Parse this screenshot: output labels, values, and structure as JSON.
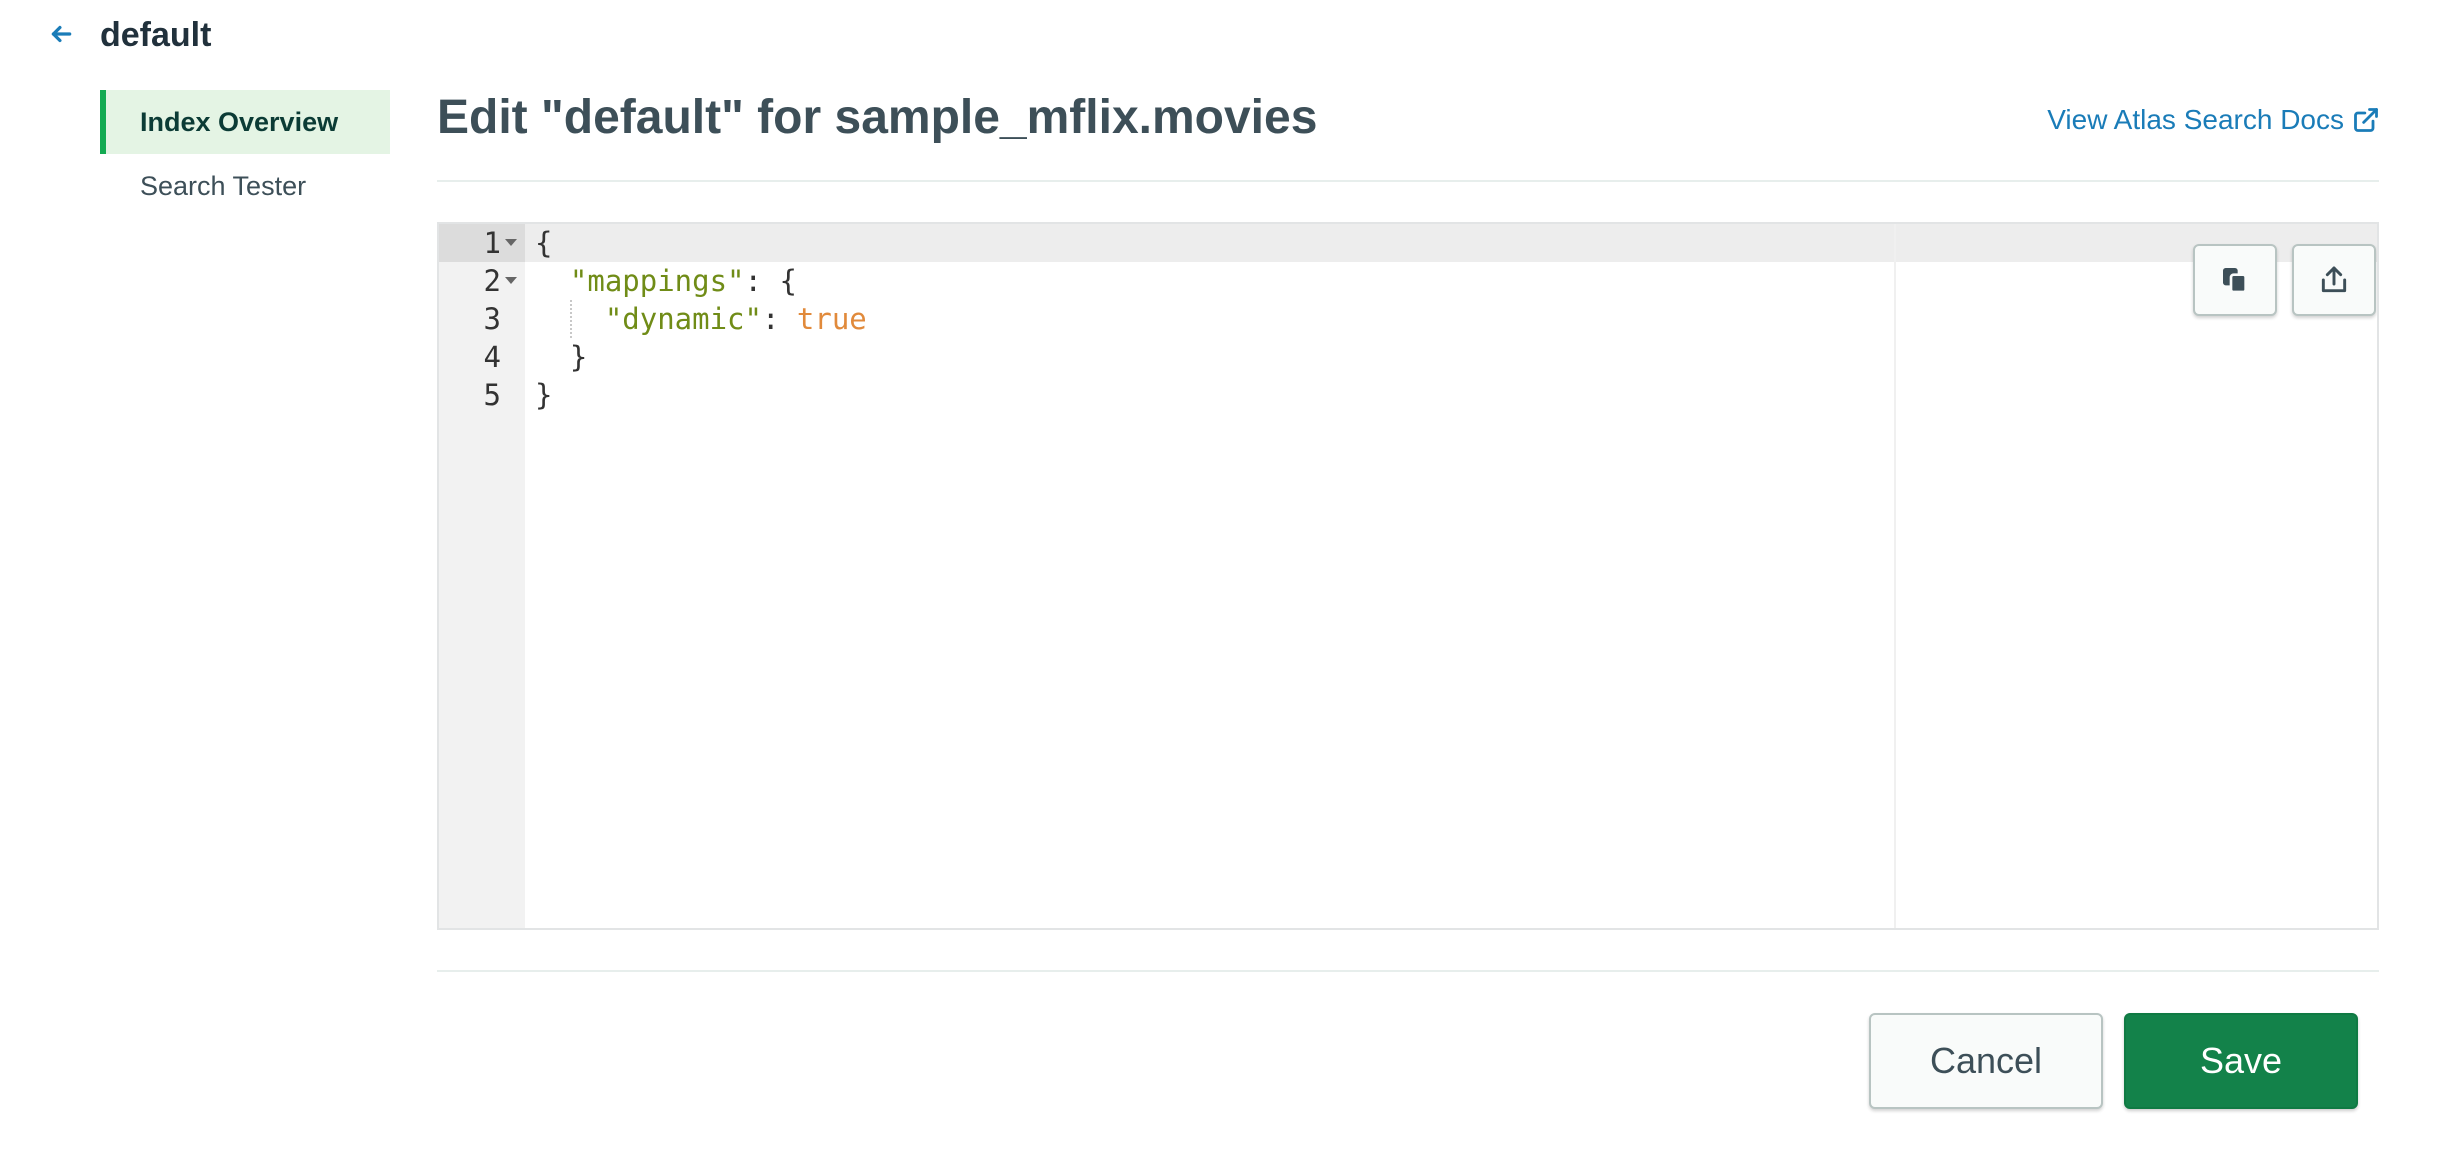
{
  "header": {
    "back_icon": "arrow-left-icon",
    "title": "default"
  },
  "sidebar": {
    "items": [
      {
        "label": "Index Overview",
        "active": true
      },
      {
        "label": "Search Tester",
        "active": false
      }
    ]
  },
  "main": {
    "title": "Edit \"default\" for sample_mflix.movies",
    "docs_link": {
      "label": "View Atlas Search Docs",
      "icon": "external-link-icon"
    }
  },
  "editor": {
    "lines": [
      {
        "num": "1",
        "parts": [
          {
            "t": "{",
            "c": "punct"
          }
        ]
      },
      {
        "num": "2",
        "parts": [
          {
            "t": "  ",
            "c": "punct"
          },
          {
            "t": "\"mappings\"",
            "c": "key"
          },
          {
            "t": ": {",
            "c": "punct"
          }
        ]
      },
      {
        "num": "3",
        "parts": [
          {
            "t": "    ",
            "c": "punct"
          },
          {
            "t": "\"dynamic\"",
            "c": "key"
          },
          {
            "t": ": ",
            "c": "punct"
          },
          {
            "t": "true",
            "c": "bool"
          }
        ]
      },
      {
        "num": "4",
        "parts": [
          {
            "t": "  }",
            "c": "punct"
          }
        ]
      },
      {
        "num": "5",
        "parts": [
          {
            "t": "}",
            "c": "punct"
          }
        ]
      }
    ],
    "copy_icon": "copy-icon",
    "export_icon": "export-icon"
  },
  "footer": {
    "cancel_label": "Cancel",
    "save_label": "Save"
  },
  "colors": {
    "accent_green": "#13aa52",
    "save_button": "#13824a",
    "link": "#1a7cb8",
    "active_nav_bg": "#e4f4e4",
    "json_key": "#708c17",
    "json_bool": "#e18a3b"
  }
}
